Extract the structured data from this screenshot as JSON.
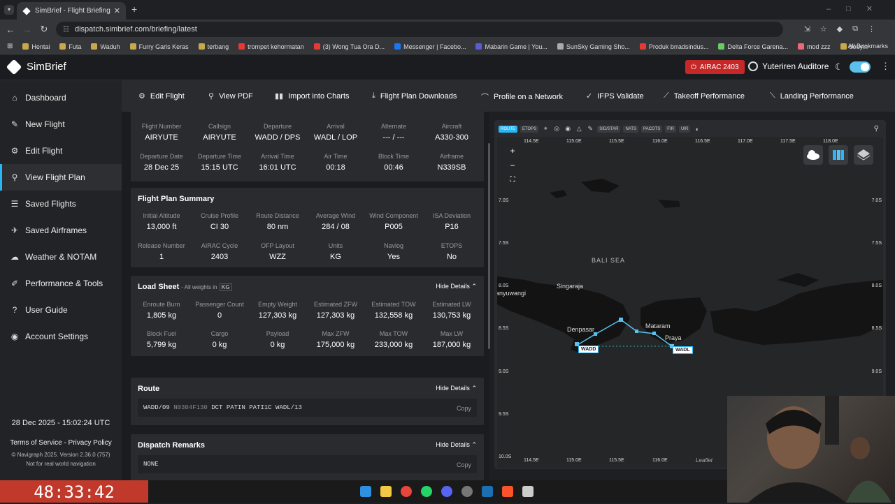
{
  "browser": {
    "tab_title": "SimBrief - Flight Briefing",
    "url": "dispatch.simbrief.com/briefing/latest",
    "bookmarks": [
      "Hentai",
      "Futa",
      "Waduh",
      "Furry Garis Keras",
      "terbang",
      "trompet kehormatan",
      "(3) Wong Tua Ora D...",
      "Messenger | Facebo...",
      "Mabarin Game | You...",
      "SunSky Gaming Sho...",
      "Produk brradsindus...",
      "Delta Force Garena...",
      "mod zzz",
      "douyin"
    ],
    "all_bookmarks": "All Bookmarks"
  },
  "app": {
    "name": "SimBrief",
    "airac": "AIRAC 2403",
    "user": "Yuteriren Auditore"
  },
  "sidebar": {
    "items": [
      {
        "label": "Dashboard",
        "icon": "home-icon",
        "glyph": "⌂"
      },
      {
        "label": "New Flight",
        "icon": "pencil-icon",
        "glyph": "✎"
      },
      {
        "label": "Edit Flight",
        "icon": "gear-icon",
        "glyph": "⚙"
      },
      {
        "label": "View Flight Plan",
        "icon": "search-icon",
        "glyph": "⚲"
      },
      {
        "label": "Saved Flights",
        "icon": "list-icon",
        "glyph": "☰"
      },
      {
        "label": "Saved Airframes",
        "icon": "plane-icon",
        "glyph": "✈"
      },
      {
        "label": "Weather & NOTAM",
        "icon": "cloud-icon",
        "glyph": "☁"
      },
      {
        "label": "Performance & Tools",
        "icon": "ruler-icon",
        "glyph": "✐"
      },
      {
        "label": "User Guide",
        "icon": "question-icon",
        "glyph": "?"
      },
      {
        "label": "Account Settings",
        "icon": "user-icon",
        "glyph": "◉"
      }
    ],
    "datetime": "28 Dec 2025 - 15:02:24 UTC",
    "terms": "Terms of Service",
    "privacy": "Privacy Policy",
    "copyright": "© Navigraph 2025. Version 2.36.0 (757)",
    "disclaimer": "Not for real world navigation"
  },
  "toolbar": [
    {
      "label": "Edit Flight",
      "glyph": "⚙"
    },
    {
      "label": "View PDF",
      "glyph": "⚲"
    },
    {
      "label": "Import into Charts",
      "glyph": "▮▮"
    },
    {
      "label": "Flight Plan Downloads",
      "glyph": "⤓"
    },
    {
      "label": "Profile on a Network",
      "glyph": "⌒"
    },
    {
      "label": "IFPS Validate",
      "glyph": "✓"
    },
    {
      "label": "Takeoff Performance",
      "glyph": "⟋"
    },
    {
      "label": "Landing Performance",
      "glyph": "⟍"
    }
  ],
  "flight": {
    "row1": [
      {
        "l": "Flight Number",
        "v": "AIRYUTE"
      },
      {
        "l": "Callsign",
        "v": "AIRYUTE"
      },
      {
        "l": "Departure",
        "v": "WADD / DPS"
      },
      {
        "l": "Arrival",
        "v": "WADL / LOP"
      },
      {
        "l": "Alternate",
        "v": "--- / ---"
      },
      {
        "l": "Aircraft",
        "v": "A330-300"
      }
    ],
    "row2": [
      {
        "l": "Departure Date",
        "v": "28 Dec 25"
      },
      {
        "l": "Departure Time",
        "v": "15:15 UTC"
      },
      {
        "l": "Arrival Time",
        "v": "16:01 UTC"
      },
      {
        "l": "Air Time",
        "v": "00:18"
      },
      {
        "l": "Block Time",
        "v": "00:46"
      },
      {
        "l": "Airframe",
        "v": "N339SB"
      }
    ]
  },
  "summary": {
    "title": "Flight Plan Summary",
    "row1": [
      {
        "l": "Initial Altitude",
        "v": "13,000 ft"
      },
      {
        "l": "Cruise Profile",
        "v": "CI 30"
      },
      {
        "l": "Route Distance",
        "v": "80 nm"
      },
      {
        "l": "Average Wind",
        "v": "284 / 08"
      },
      {
        "l": "Wind Component",
        "v": "P005"
      },
      {
        "l": "ISA Deviation",
        "v": "P16"
      }
    ],
    "row2": [
      {
        "l": "Release Number",
        "v": "1"
      },
      {
        "l": "AIRAC Cycle",
        "v": "2403"
      },
      {
        "l": "OFP Layout",
        "v": "WZZ"
      },
      {
        "l": "Units",
        "v": "KG"
      },
      {
        "l": "Navlog",
        "v": "Yes"
      },
      {
        "l": "ETOPS",
        "v": "No"
      }
    ]
  },
  "loadsheet": {
    "title": "Load Sheet",
    "sub": "- All weights in",
    "unit": "KG",
    "hide": "Hide Details",
    "row1": [
      {
        "l": "Enroute Burn",
        "v": "1,805 kg"
      },
      {
        "l": "Passenger Count",
        "v": "0"
      },
      {
        "l": "Empty Weight",
        "v": "127,303 kg"
      },
      {
        "l": "Estimated ZFW",
        "v": "127,303 kg"
      },
      {
        "l": "Estimated TOW",
        "v": "132,558 kg"
      },
      {
        "l": "Estimated LW",
        "v": "130,753 kg"
      }
    ],
    "row2": [
      {
        "l": "Block Fuel",
        "v": "5,799 kg"
      },
      {
        "l": "Cargo",
        "v": "0 kg"
      },
      {
        "l": "Payload",
        "v": "0 kg"
      },
      {
        "l": "Max ZFW",
        "v": "175,000 kg"
      },
      {
        "l": "Max TOW",
        "v": "233,000 kg"
      },
      {
        "l": "Max LW",
        "v": "187,000 kg"
      }
    ]
  },
  "route": {
    "title": "Route",
    "hide": "Hide Details",
    "text_a": "WADD/09",
    "text_b": "N0304F130",
    "text_c": "DCT PATIN PATI1C WADL/13",
    "copy": "Copy"
  },
  "remarks": {
    "title": "Dispatch Remarks",
    "hide": "Hide Details",
    "text": "NONE",
    "copy": "Copy"
  },
  "map": {
    "buttons": [
      "ROUTE",
      "ETOPS",
      "SID/STAR",
      "NATS",
      "PACOTS",
      "FIR",
      "UIR"
    ],
    "lon_labels": [
      "114.5E",
      "115.0E",
      "115.5E",
      "116.0E",
      "116.5E",
      "117.0E",
      "117.5E",
      "118.0E"
    ],
    "lat_labels": [
      "7.0S",
      "7.5S",
      "8.0S",
      "8.5S",
      "9.0S",
      "9.5S",
      "10.0S"
    ],
    "places": [
      "BALI SEA",
      "Singaraja",
      "Banyuwangi",
      "Denpasar",
      "Mataram",
      "Praya"
    ],
    "origin": "WADD",
    "dest": "WADL",
    "attribution": "Leaflet"
  },
  "overlay": {
    "timer": "48:33:42"
  },
  "colors": {
    "accent": "#29b6f6",
    "airac": "#c62828",
    "route": "#5bc0eb"
  }
}
